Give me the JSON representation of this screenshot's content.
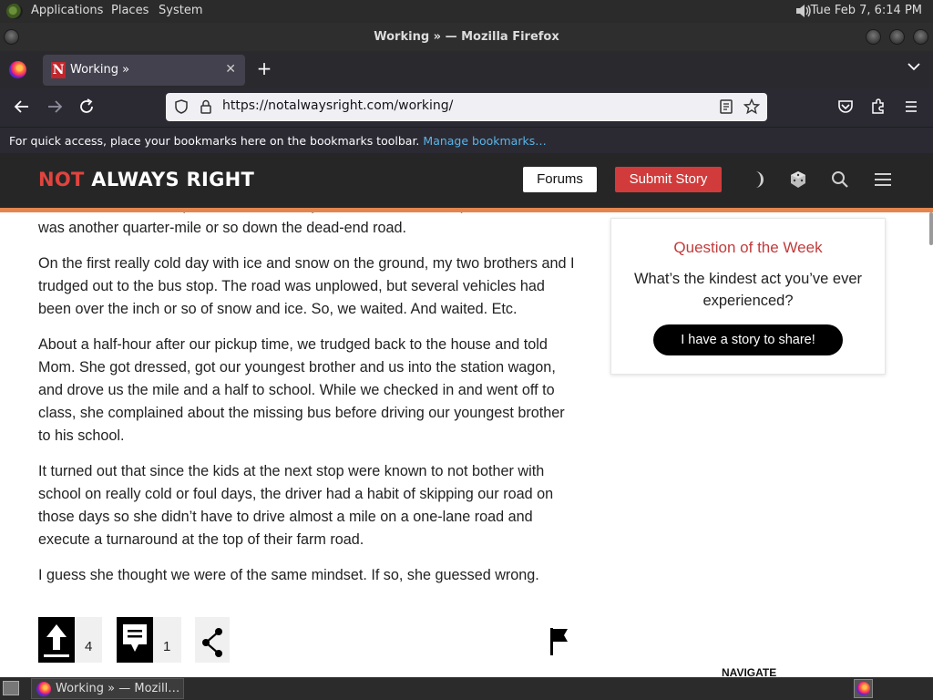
{
  "desktop_panel": {
    "menus": [
      "Applications",
      "Places",
      "System"
    ],
    "clock": "Tue Feb  7,  6:14 PM"
  },
  "window": {
    "title": "Working » — Mozilla Firefox"
  },
  "browser": {
    "tab": {
      "title": "Working »",
      "favicon_letter": "N"
    },
    "url": "https://notalwaysright.com/working/",
    "bookmarks_hint": "For quick access, place your bookmarks here on the bookmarks toolbar.",
    "bookmarks_link": "Manage bookmarks…"
  },
  "site": {
    "logo_not": "NOT",
    "logo_rest": "ALWAYS RIGHT",
    "forums_label": "Forums",
    "submit_label": "Submit Story",
    "colors": {
      "accent_red": "#d13b3b",
      "header_bg": "#262626",
      "orange_rule": "#e3854f"
    }
  },
  "article": {
    "paragraphs": [
      "row at the end of our quarter-mile driveway. We were the first stop, and the second was another quarter-mile or so down the dead-end road.",
      "On the first really cold day with ice and snow on the ground, my two brothers and I trudged out to the bus stop. The road was unplowed, but several vehicles had been over the inch or so of snow and ice. So, we waited. And waited. Etc.",
      "About a half-hour after our pickup time, we trudged back to the house and told Mom. She got dressed, got our youngest brother and us into the station wagon, and drove us the mile and a half to school. While we checked in and went off to class, she complained about the missing bus before driving our youngest brother to his school.",
      "It turned out that since the kids at the next stop were known to not bother with school on really cold or foul days, the driver had a habit of skipping our road on those days so she didn’t have to drive almost a mile on a one-lane road and execute a turnaround at the top of their farm road.",
      "I guess she thought we were of the same mindset. If so, she guessed wrong."
    ],
    "upvotes": "4",
    "comments": "1"
  },
  "sidebar": {
    "qotw_title": "Question of the Week",
    "qotw_question": "What’s the kindest act you’ve ever experienced?",
    "qotw_button": "I have a story to share!",
    "navigate_label": "NAVIGATE"
  },
  "taskbar": {
    "task_label": "Working » — Mozill…"
  }
}
